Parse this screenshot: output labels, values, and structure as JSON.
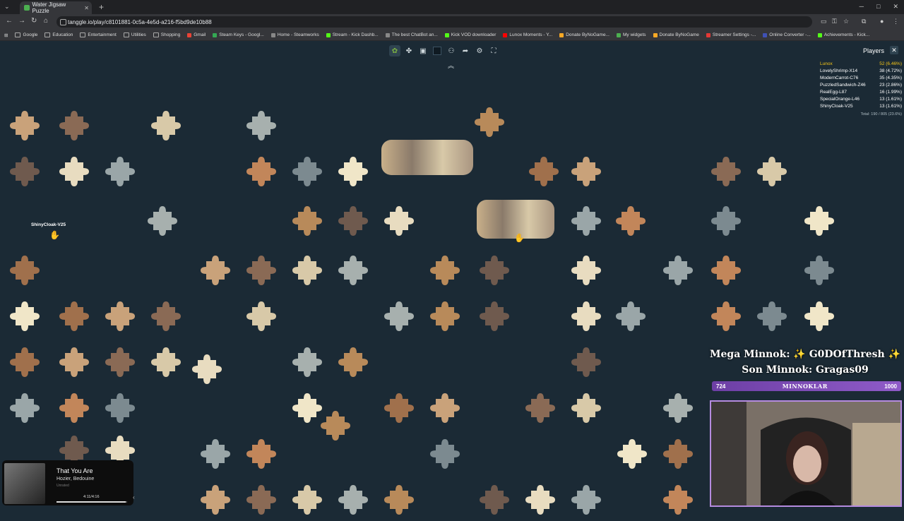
{
  "browser": {
    "tab_title": "Water Jigsaw Puzzle",
    "url": "tanggle.io/play/c8101881-0c5a-4e5d-a216-f5bd9de10b88",
    "bookmarks": [
      "Google",
      "Education",
      "Entertainment",
      "Utilities",
      "Shopping",
      "Gmail",
      "Steam Keys - Googl...",
      "Home - Steamworks",
      "Stream - Kick Dashb...",
      "The best ChatBot an...",
      "Kick VOD downloader",
      "Lunox Moments - Y...",
      "Donate ByNoGame...",
      "My widgets",
      "Donate ByNoGame",
      "Streamer Settings -...",
      "Online Converter -...",
      "Achievements - Kick..."
    ]
  },
  "toolbar": {
    "collapse_icon": "chevron-up-double"
  },
  "players": {
    "header": "Players",
    "list": [
      {
        "name": "Lunox",
        "score": "52 (6.46%)"
      },
      {
        "name": "LovelyShrimp-X14",
        "score": "38 (4.72%)"
      },
      {
        "name": "ModernCarrot-C76",
        "score": "35 (4.35%)"
      },
      {
        "name": "PuzzledSandwich-Z46",
        "score": "23 (2.86%)"
      },
      {
        "name": "RealEgg-L87",
        "score": "16 (1.99%)"
      },
      {
        "name": "SpecialOrange-L46",
        "score": "13 (1.61%)"
      },
      {
        "name": "ShinyCloak-V25",
        "score": "13 (1.61%)"
      }
    ],
    "total": "Total: 190 / 805 (23.6%)"
  },
  "cursor_label": "ShinyCloak-V25",
  "stream_overlay": {
    "line1": "Mega Minnok: ✨ G0DOfThresh ✨",
    "line2": "Son Minnok: Gragas09",
    "xp_left": "724",
    "xp_center": "MINNOKLAR",
    "xp_right": "1000"
  },
  "music": {
    "song": "That You Are",
    "artist": "Hozier, Bedouine",
    "sub": "Unrated",
    "time": "4:11/4:16",
    "progress": 0.98
  },
  "colors": {
    "board_bg": "#1b2a35",
    "accent_gold": "#f5c518",
    "xp_purple": "#8f5bc8"
  }
}
